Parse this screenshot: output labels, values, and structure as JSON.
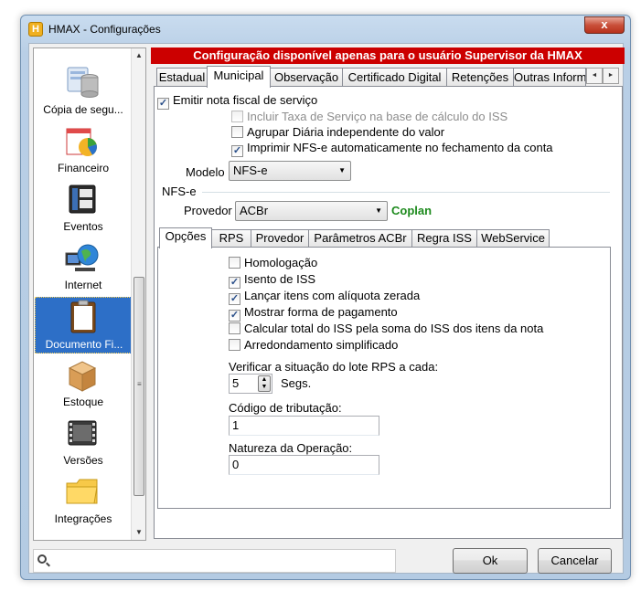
{
  "window": {
    "title": "HMAX - Configurações",
    "app_icon_letter": "H",
    "close_glyph": "x"
  },
  "nav": {
    "items": [
      {
        "label": "Cópia de segu...",
        "icon": "backup-database-icon"
      },
      {
        "label": "Financeiro",
        "icon": "pie-chart-icon"
      },
      {
        "label": "Eventos",
        "icon": "wallet-icon"
      },
      {
        "label": "Internet",
        "icon": "globe-network-icon"
      },
      {
        "label": "Documento Fi...",
        "icon": "clipboard-icon",
        "selected": true
      },
      {
        "label": "Estoque",
        "icon": "box-icon"
      },
      {
        "label": "Versões",
        "icon": "film-strip-icon"
      },
      {
        "label": "Integrações",
        "icon": "folder-icon"
      }
    ],
    "scroll_up": "▲",
    "scroll_down": "▼",
    "scroll_grip": "≡"
  },
  "banner": "Configuração disponível apenas para o usuário Supervisor da HMAX",
  "tabs": [
    "Estadual",
    "Municipal",
    "Observação",
    "Certificado Digital",
    "Retenções",
    "Outras Inform"
  ],
  "active_tab": "Municipal",
  "tab_arrows": {
    "left": "◄",
    "right": "►"
  },
  "municipal": {
    "emitir": {
      "label": "Emitir nota fiscal de serviço",
      "checked": true
    },
    "incluir_taxa": {
      "label": "Incluir Taxa de Serviço na base de cálculo do ISS",
      "checked": false
    },
    "agrupar": {
      "label": "Agrupar Diária independente do valor",
      "checked": false
    },
    "imprimir": {
      "label": "Imprimir NFS-e automaticamente no fechamento da conta",
      "checked": true
    },
    "modelo_label": "Modelo",
    "modelo_value": "NFS-e",
    "group_title": "NFS-e",
    "provedor_label": "Provedor",
    "provedor_value": "ACBr",
    "provedor_name": "Coplan",
    "subtabs": [
      "Opções",
      "RPS",
      "Provedor",
      "Parâmetros ACBr",
      "Regra ISS",
      "WebService"
    ],
    "active_subtab": "Opções",
    "opcoes": [
      {
        "label": "Homologação",
        "checked": false
      },
      {
        "label": "Isento de ISS",
        "checked": true
      },
      {
        "label": "Lançar itens com alíquota zerada",
        "checked": true
      },
      {
        "label": "Mostrar forma de pagamento",
        "checked": true
      },
      {
        "label": "Calcular total do ISS pela soma do ISS dos itens da nota",
        "checked": false
      },
      {
        "label": "Arredondamento simplificado",
        "checked": false
      }
    ],
    "verificar_label": "Verificar a situação do lote RPS a cada:",
    "verificar_value": "5",
    "verificar_unit": "Segs.",
    "codigo_label": "Código de tributação:",
    "codigo_value": "1",
    "natureza_label": "Natureza da Operação:",
    "natureza_value": "0"
  },
  "buttons": {
    "ok": "Ok",
    "cancel": "Cancelar"
  },
  "glyphs": {
    "check": "✓",
    "combo_arrow": "▼",
    "spin_up": "▲",
    "spin_down": "▼"
  }
}
